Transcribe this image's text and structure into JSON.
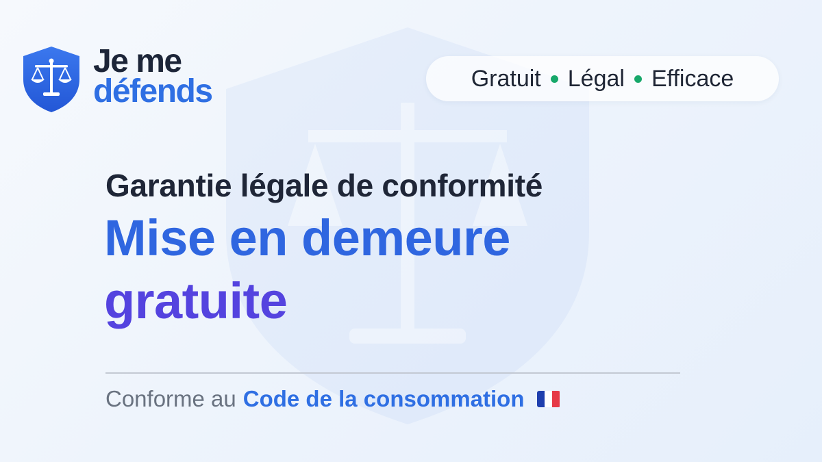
{
  "brand": {
    "line1": "Je me",
    "line2": "défends"
  },
  "badge": {
    "items": [
      "Gratuit",
      "Légal",
      "Efficace"
    ]
  },
  "heading": {
    "subtitle": "Garantie légale de conformité",
    "title_line1": "Mise en demeure",
    "title_line2": "gratuite"
  },
  "footer": {
    "prefix": "Conforme au",
    "highlight": "Code de la consommation"
  },
  "icons": {
    "logo": "shield-scales-icon",
    "flag": "flag-france-icon",
    "watermark": "shield-scales-watermark"
  },
  "colors": {
    "primary_blue": "#2f6fe3",
    "violet": "#5443df",
    "dark": "#1f2637",
    "green_dot": "#17a86a"
  }
}
